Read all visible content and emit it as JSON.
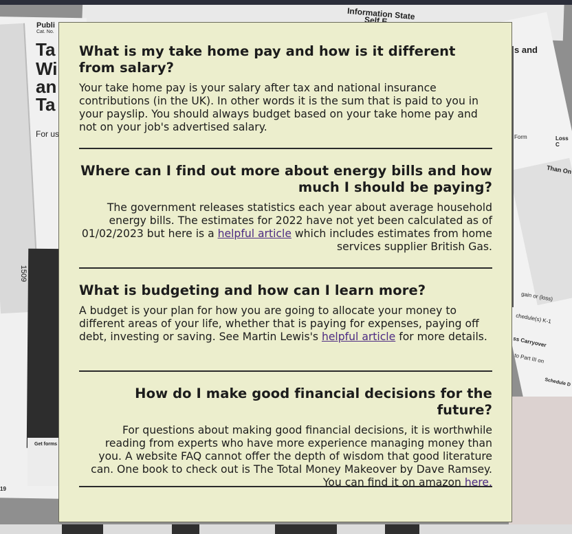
{
  "background": {
    "texts": [
      "Publi",
      "Cat. No.",
      "Ta",
      "Wi",
      "an",
      "Ta",
      "For us",
      "1509",
      "19",
      "Get forms",
      "Information State",
      "Self E",
      "s and",
      "Form",
      "Loss C",
      "Than On",
      "gain or (loss)",
      "chedule(s) K-1",
      "ss Carryover",
      "to Part III on",
      "Schedule D"
    ]
  },
  "faq": [
    {
      "question": "What is my take home pay and how is it different from salary?",
      "answer_parts": [
        "Your take home pay is your salary after tax and national insurance contributions (in the UK). In other words it is the sum that is paid to you in your payslip. You should always budget based on your take home pay and not on your job's advertised salary."
      ],
      "align": "left"
    },
    {
      "question": "Where can I find out more about energy bills and how much I should be paying?",
      "answer_before": "The government releases statistics each year about average household energy bills. The estimates for 2022 have not yet been calculated as of 01/02/2023 but here is a ",
      "link_label": "helpful article",
      "answer_after": " which includes estimates from home services supplier British Gas.",
      "align": "right"
    },
    {
      "question": "What is budgeting and how can I learn more?",
      "answer_before": "A budget is your plan for how you are going to allocate your money to different areas of your life, whether that is paying for expenses, paying off debt, investing or saving. See Martin Lewis's ",
      "link_label": "helpful article",
      "answer_after": " for more details.",
      "align": "left"
    },
    {
      "question": "How do I make good financial decisions for the future?",
      "answer_before": "For questions about making good financial decisions, it is worthwhile reading from experts who have more experience managing money than you. A website FAQ cannot offer the depth of wisdom that good literature can. One book to check out is The Total Money Makeover by Dave Ramsey. You can find it on amazon ",
      "link_label": "here.",
      "answer_after": "",
      "align": "right"
    }
  ],
  "colors": {
    "panel_bg": "#eceecd",
    "link": "#4c2a82",
    "text": "#1c1c1c"
  }
}
